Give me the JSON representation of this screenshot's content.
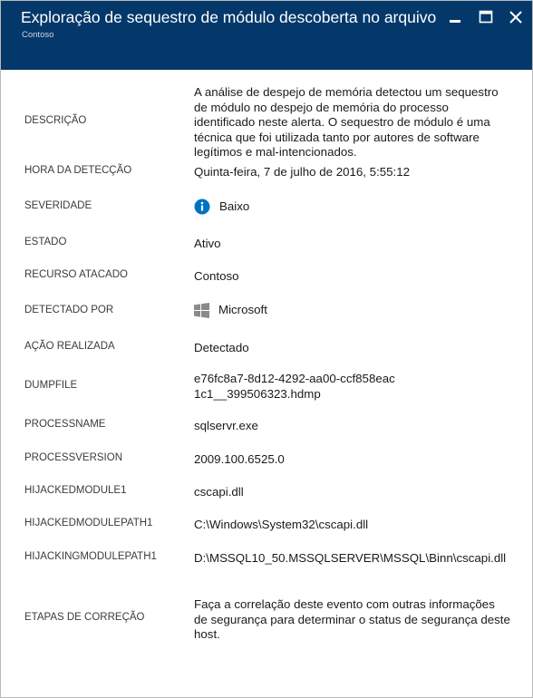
{
  "window": {
    "title": "Exploração de sequestro de módulo descoberta no arquivo...",
    "subtitle": "Contoso",
    "controls": {
      "minimize_icon": "minimize-icon",
      "maximize_icon": "maximize-icon",
      "close_icon": "close-icon"
    }
  },
  "details": [
    {
      "label": "DESCRIÇÃO",
      "value": "A análise de despejo de memória detectou um sequestro de módulo no despejo de memória do processo identificado neste alerta. O sequestro de módulo é uma técnica que foi utilizada tanto por autores de software legítimos e mal-intencionados."
    },
    {
      "label": "HORA DA DETECÇÃO",
      "value": "Quinta-feira, 7 de julho de 2016, 5:55:12"
    },
    {
      "label": "SEVERIDADE",
      "value": "Baixo",
      "icon": "info-icon",
      "icon_color": "#0072c6"
    },
    {
      "label": "ESTADO",
      "value": "Ativo"
    },
    {
      "label": "RECURSO ATACADO",
      "value": "Contoso"
    },
    {
      "label": "DETECTADO POR",
      "value": "Microsoft",
      "icon": "windows-logo-icon",
      "icon_color": "#8a8a8a"
    },
    {
      "label": "AÇÃO REALIZADA",
      "value": "Detectado"
    },
    {
      "label": "DUMPFILE",
      "value": "e76fc8a7-8d12-4292-aa00-ccf858eac1c1__399506323.hdmp"
    },
    {
      "label": "PROCESSNAME",
      "value": "sqlservr.exe"
    },
    {
      "label": "PROCESSVERSION",
      "value": "2009.100.6525.0"
    },
    {
      "label": "HIJACKEDMODULE1",
      "value": "cscapi.dll"
    },
    {
      "label": "HIJACKEDMODULEPATH1",
      "value": "C:\\Windows\\System32\\cscapi.dll"
    },
    {
      "label": "HIJACKINGMODULEPATH1",
      "value": "D:\\MSSQL10_50.MSSQLSERVER\\MSSQL\\Binn\\cscapi.dll"
    },
    {
      "label": "ETAPAS DE CORREÇÃO",
      "value": "Faça a correlação deste evento com outras informações de segurança para determinar o status de segurança deste host."
    }
  ],
  "colors": {
    "header_background": "#05386a",
    "header_text": "#ffffff",
    "label_text": "#3b3b3b",
    "value_text": "#1a1a1a"
  }
}
